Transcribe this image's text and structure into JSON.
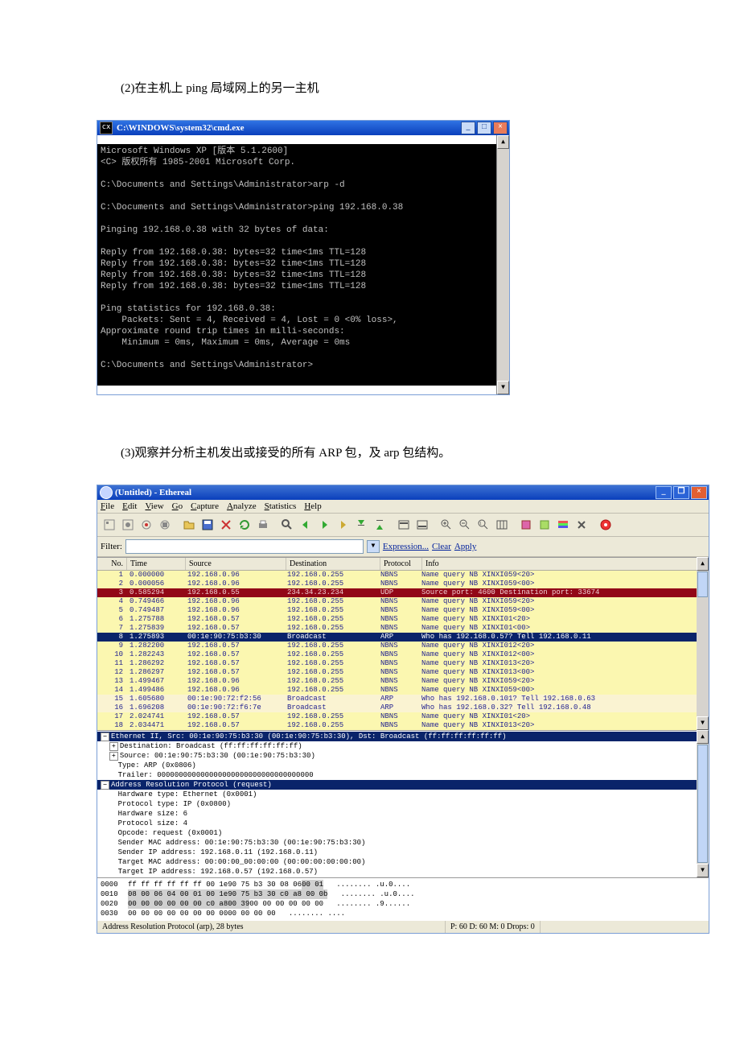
{
  "caption_1": "(2)在主机上 ping 局域网上的另一主机",
  "caption_2": "(3)观察并分析主机发出或接受的所有 ARP 包，及 arp 包结构。",
  "cmd": {
    "title": "C:\\WINDOWS\\system32\\cmd.exe",
    "icon_glyph": "cx",
    "body": "Microsoft Windows XP [版本 5.1.2600]\n<C> 版权所有 1985-2001 Microsoft Corp.\n\nC:\\Documents and Settings\\Administrator>arp -d\n\nC:\\Documents and Settings\\Administrator>ping 192.168.0.38\n\nPinging 192.168.0.38 with 32 bytes of data:\n\nReply from 192.168.0.38: bytes=32 time<1ms TTL=128\nReply from 192.168.0.38: bytes=32 time<1ms TTL=128\nReply from 192.168.0.38: bytes=32 time<1ms TTL=128\nReply from 192.168.0.38: bytes=32 time<1ms TTL=128\n\nPing statistics for 192.168.0.38:\n    Packets: Sent = 4, Received = 4, Lost = 0 <0% loss>,\nApproximate round trip times in milli-seconds:\n    Minimum = 0ms, Maximum = 0ms, Average = 0ms\n\nC:\\Documents and Settings\\Administrator>"
  },
  "eth": {
    "title": "(Untitled) - Ethereal",
    "menus": [
      "File",
      "Edit",
      "View",
      "Go",
      "Capture",
      "Analyze",
      "Statistics",
      "Help"
    ],
    "filter_label": "Filter:",
    "filter_value": "",
    "expr": "Expression...",
    "clear": "Clear",
    "apply": "Apply",
    "hdr": {
      "no": "No.",
      "time": "Time",
      "src": "Source",
      "dst": "Destination",
      "proto": "Protocol",
      "info": "Info"
    },
    "packets": [
      {
        "no": "1",
        "time": "0.000000",
        "src": "192.168.0.96",
        "dst": "192.168.0.255",
        "proto": "NBNS",
        "info": "Name query NB XINXI059<20>",
        "cls": "yellow"
      },
      {
        "no": "2",
        "time": "0.000056",
        "src": "192.168.0.96",
        "dst": "192.168.0.255",
        "proto": "NBNS",
        "info": "Name query NB XINXI059<00>",
        "cls": "yellow"
      },
      {
        "no": "3",
        "time": "0.585294",
        "src": "192.168.0.55",
        "dst": "234.34.23.234",
        "proto": "UDP",
        "info": "Source port: 4600  Destination port: 33674",
        "cls": "red"
      },
      {
        "no": "4",
        "time": "0.749466",
        "src": "192.168.0.96",
        "dst": "192.168.0.255",
        "proto": "NBNS",
        "info": "Name query NB XINXI059<20>",
        "cls": "yellow"
      },
      {
        "no": "5",
        "time": "0.749487",
        "src": "192.168.0.96",
        "dst": "192.168.0.255",
        "proto": "NBNS",
        "info": "Name query NB XINXI059<00>",
        "cls": "yellow"
      },
      {
        "no": "6",
        "time": "1.275788",
        "src": "192.168.0.57",
        "dst": "192.168.0.255",
        "proto": "NBNS",
        "info": "Name query NB XINXI01<20>",
        "cls": "yellow"
      },
      {
        "no": "7",
        "time": "1.275839",
        "src": "192.168.0.57",
        "dst": "192.168.0.255",
        "proto": "NBNS",
        "info": "Name query NB XINXI01<00>",
        "cls": "yellow"
      },
      {
        "no": "8",
        "time": "1.275893",
        "src": "00:1e:90:75:b3:30",
        "dst": "Broadcast",
        "proto": "ARP",
        "info": "Who has 192.168.0.57?  Tell 192.168.0.11",
        "cls": "navy"
      },
      {
        "no": "9",
        "time": "1.282200",
        "src": "192.168.0.57",
        "dst": "192.168.0.255",
        "proto": "NBNS",
        "info": "Name query NB XINXI012<20>",
        "cls": "yellow"
      },
      {
        "no": "10",
        "time": "1.282243",
        "src": "192.168.0.57",
        "dst": "192.168.0.255",
        "proto": "NBNS",
        "info": "Name query NB XINXI012<00>",
        "cls": "yellow"
      },
      {
        "no": "11",
        "time": "1.286292",
        "src": "192.168.0.57",
        "dst": "192.168.0.255",
        "proto": "NBNS",
        "info": "Name query NB XINXI013<20>",
        "cls": "yellow"
      },
      {
        "no": "12",
        "time": "1.286297",
        "src": "192.168.0.57",
        "dst": "192.168.0.255",
        "proto": "NBNS",
        "info": "Name query NB XINXI013<00>",
        "cls": "yellow"
      },
      {
        "no": "13",
        "time": "1.499467",
        "src": "192.168.0.96",
        "dst": "192.168.0.255",
        "proto": "NBNS",
        "info": "Name query NB XINXI059<20>",
        "cls": "yellow"
      },
      {
        "no": "14",
        "time": "1.499486",
        "src": "192.168.0.96",
        "dst": "192.168.0.255",
        "proto": "NBNS",
        "info": "Name query NB XINXI059<00>",
        "cls": "yellow"
      },
      {
        "no": "15",
        "time": "1.605680",
        "src": "00:1e:90:72:f2:56",
        "dst": "Broadcast",
        "proto": "ARP",
        "info": "Who has 192.168.0.101?  Tell 192.168.0.63",
        "cls": "cream"
      },
      {
        "no": "16",
        "time": "1.696208",
        "src": "00:1e:90:72:f6:7e",
        "dst": "Broadcast",
        "proto": "ARP",
        "info": "Who has 192.168.0.32?  Tell 192.168.0.48",
        "cls": "cream"
      },
      {
        "no": "17",
        "time": "2.024741",
        "src": "192.168.0.57",
        "dst": "192.168.0.255",
        "proto": "NBNS",
        "info": "Name query NB XINXI01<20>",
        "cls": "yellow"
      },
      {
        "no": "18",
        "time": "2.034471",
        "src": "192.168.0.57",
        "dst": "192.168.0.255",
        "proto": "NBNS",
        "info": "Name query NB XINXI013<20>",
        "cls": "yellow"
      }
    ],
    "detail": {
      "l0": "Ethernet II, Src: 00:1e:90:75:b3:30 (00:1e:90:75:b3:30), Dst: Broadcast (ff:ff:ff:ff:ff:ff)",
      "l1": "Destination: Broadcast (ff:ff:ff:ff:ff:ff)",
      "l2": "Source: 00:1e:90:75:b3:30 (00:1e:90:75:b3:30)",
      "l3": "Type: ARP (0x0806)",
      "l4": "Trailer: 000000000000000000000000000000000000",
      "l5": "Address Resolution Protocol (request)",
      "l6": "Hardware type: Ethernet (0x0001)",
      "l7": "Protocol type: IP (0x0800)",
      "l8": "Hardware size: 6",
      "l9": "Protocol size: 4",
      "l10": "Opcode: request (0x0001)",
      "l11": "Sender MAC address: 00:1e:90:75:b3:30 (00:1e:90:75:b3:30)",
      "l12": "Sender IP address: 192.168.0.11 (192.168.0.11)",
      "l13": "Target MAC address: 00:00:00_00:00:00 (00:00:00:00:00:00)",
      "l14": "Target IP address: 192.168.0.57 (192.168.0.57)"
    },
    "hex": [
      {
        "off": "0000",
        "b1": "ff ff ff ff ff ff 00 1e",
        "b2": "90 75 b3 30 08 06",
        "b3": "00 01",
        "a": "........ .u.0....",
        "hl": false,
        "hl3": true
      },
      {
        "off": "0010",
        "b1": "08 00 06 04 00 01 00 1e",
        "b2": "90 75 b3 30 c0 a8 00 0b",
        "b3": "",
        "a": "........ .u.0....",
        "hl": true
      },
      {
        "off": "0020",
        "b1": "00 00 00 00 00 00 c0 a8",
        "b2": "00 39",
        "b3": "00 00 00 00 00 00",
        "a": "........ .9......",
        "hl": true,
        "hl3": false
      },
      {
        "off": "0030",
        "b1": "00 00 00 00 00 00 00 00",
        "b2": "00 00 00 00",
        "b3": "",
        "a": "........ ....",
        "hl": false
      }
    ],
    "status_left": "Address Resolution Protocol (arp), 28 bytes",
    "status_right": "P: 60 D: 60 M: 0 Drops: 0"
  }
}
